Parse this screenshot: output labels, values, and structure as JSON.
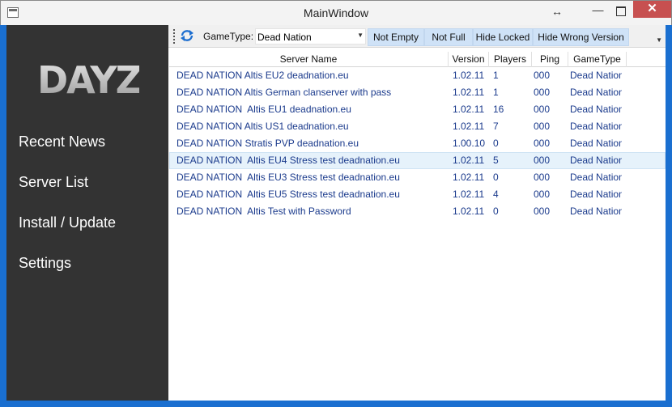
{
  "window": {
    "title": "MainWindow",
    "close_glyph": "✕",
    "minimize_glyph": "—",
    "resize_glyph": "↔"
  },
  "sidebar": {
    "logo_text": "DAYZ",
    "items": [
      {
        "label": "Recent News"
      },
      {
        "label": "Server List"
      },
      {
        "label": "Install / Update"
      },
      {
        "label": "Settings"
      }
    ],
    "background": "#333333"
  },
  "toolbar": {
    "gametype_label": "GameType:",
    "gametype_value": "Dead Nation",
    "buttons": [
      {
        "label": "Not Empty"
      },
      {
        "label": "Not Full"
      },
      {
        "label": "Hide Locked"
      },
      {
        "label": "Hide Wrong Version"
      }
    ],
    "refresh_icon": "refresh-icon"
  },
  "grid": {
    "columns": [
      "Server Name",
      "Version",
      "Players",
      "Ping",
      "GameType"
    ],
    "rows": [
      {
        "name": "DEAD NATION Altis EU2 deadnation.eu",
        "version": "1.02.11",
        "players": "1",
        "ping": "000",
        "gametype": "Dead Nation"
      },
      {
        "name": "DEAD NATION Altis German clanserver with pass",
        "version": "1.02.11",
        "players": "1",
        "ping": "000",
        "gametype": "Dead Nation"
      },
      {
        "name": "DEAD NATION  Altis EU1 deadnation.eu",
        "version": "1.02.11",
        "players": "16",
        "ping": "000",
        "gametype": "Dead Nation"
      },
      {
        "name": "DEAD NATION Altis US1 deadnation.eu",
        "version": "1.02.11",
        "players": "7",
        "ping": "000",
        "gametype": "Dead Nation"
      },
      {
        "name": "DEAD NATION Stratis PVP deadnation.eu",
        "version": "1.00.10",
        "players": "0",
        "ping": "000",
        "gametype": "Dead Nation"
      },
      {
        "name": "DEAD NATION  Altis EU4 Stress test deadnation.eu",
        "version": "1.02.11",
        "players": "5",
        "ping": "000",
        "gametype": "Dead Nation",
        "selected": true
      },
      {
        "name": "DEAD NATION  Altis EU3 Stress test deadnation.eu",
        "version": "1.02.11",
        "players": "0",
        "ping": "000",
        "gametype": "Dead Nation"
      },
      {
        "name": "DEAD NATION  Altis EU5 Stress test deadnation.eu",
        "version": "1.02.11",
        "players": "4",
        "ping": "000",
        "gametype": "Dead Nation"
      },
      {
        "name": "DEAD NATION  Altis Test with Password",
        "version": "1.02.11",
        "players": "0",
        "ping": "000",
        "gametype": "Dead Nation"
      }
    ]
  },
  "colors": {
    "accent": "#1a6fd0",
    "close_button": "#c75050",
    "row_text": "#1a3a8c",
    "selected_row": "#e6f2fb"
  }
}
